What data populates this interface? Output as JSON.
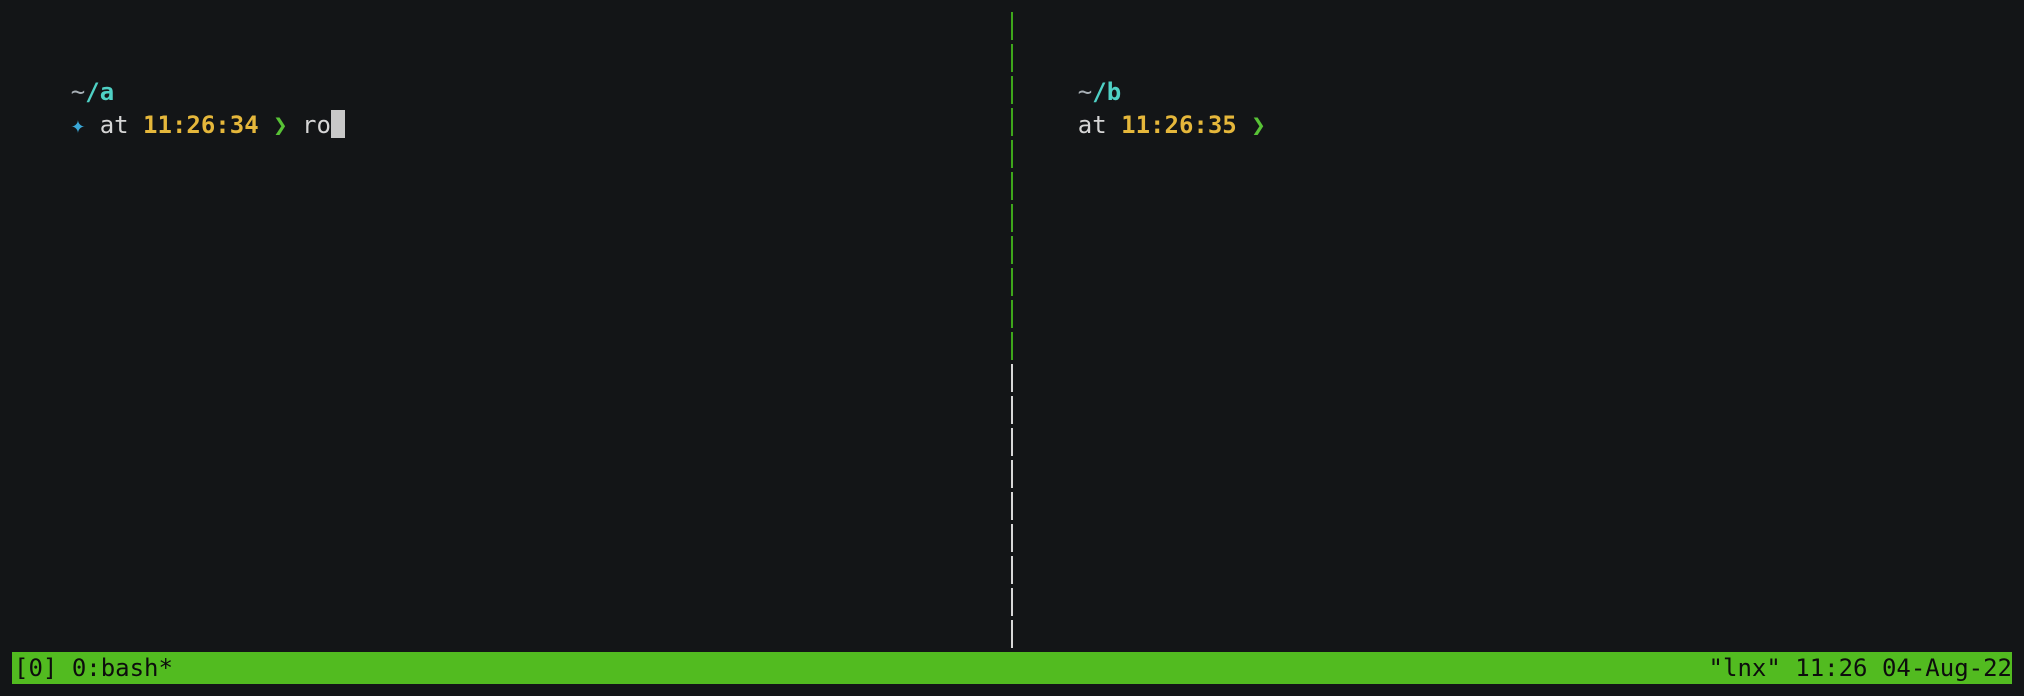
{
  "left_pane": {
    "cwd_tilde": "~",
    "cwd_path": "/a",
    "prompt_marker": "✦",
    "at_label": " at ",
    "time": "11:26:34",
    "chevron": " ❯ ",
    "typed_command": "ro"
  },
  "right_pane": {
    "cwd_tilde": "~",
    "cwd_path": "/b",
    "at_label": "at ",
    "time": "11:26:35",
    "chevron": " ❯"
  },
  "status_bar": {
    "session": "[0]",
    "window": "0:bash*",
    "host": "\"lnx\"",
    "clock": "11:26",
    "date": "04-Aug-22"
  },
  "colors": {
    "background": "#131517",
    "status_bar": "#52bb20",
    "cwd": "#4fd1c5",
    "time": "#e5b73b",
    "chevron": "#58c236",
    "active_divider": "#3ea61b"
  }
}
